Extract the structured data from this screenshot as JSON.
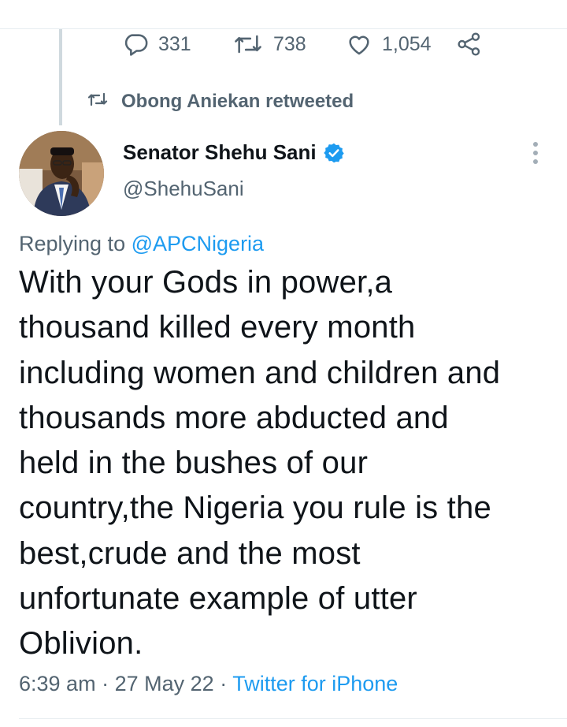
{
  "actions": {
    "reply_count": "331",
    "retweet_count": "738",
    "like_count": "1,054",
    "icons": [
      "reply-icon",
      "retweet-icon",
      "like-icon",
      "share-icon"
    ]
  },
  "retweet_context": {
    "label": "Obong Aniekan retweeted"
  },
  "author": {
    "name": "Senator Shehu Sani",
    "handle": "@ShehuSani",
    "verified": true
  },
  "replying": {
    "prefix": "Replying to",
    "mention": "@APCNigeria"
  },
  "tweet": {
    "text": "With your Gods in power,a\nthousand killed every month\nincluding women and children and\nthousands more abducted and\nheld in the bushes of our\ncountry,the Nigeria you rule  is the\nbest,crude and the most\nunfortunate example of utter\nOblivion."
  },
  "meta": {
    "time": "6:39 am",
    "separator": "·",
    "date": "27 May 22",
    "source": "Twitter for iPhone"
  },
  "colors": {
    "accent": "#1d9bf0",
    "secondary_text": "#536471"
  }
}
